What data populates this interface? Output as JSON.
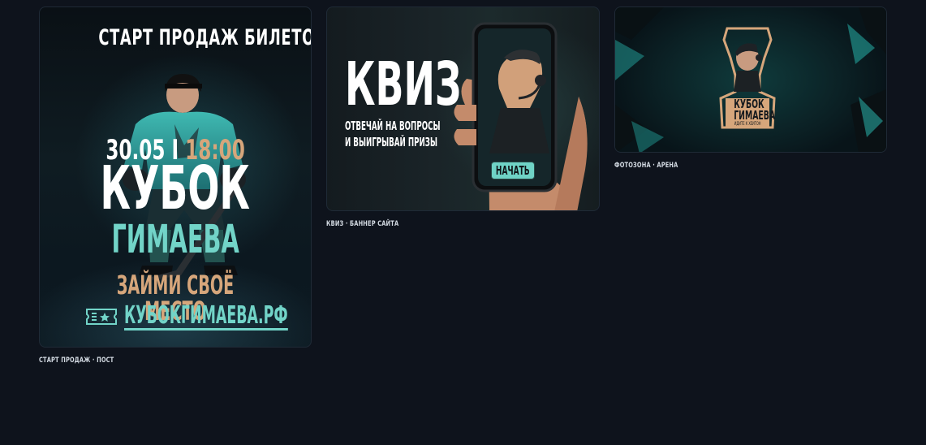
{
  "cards": [
    {
      "id": "poster",
      "top_text": "СТАРТ ПРОДАЖ БИЛЕТОВ",
      "date": "30.05 I",
      "time": "18:00",
      "title": "КУБОК",
      "name": "ГИМАЕВА",
      "slogan": "ЗАЙМИ СВОЁ МЕСТО",
      "site": "КУБОКГИМАЕВА.РФ",
      "caption": "СТАРТ ПРОДАЖ · ПОСТ"
    },
    {
      "id": "quiz",
      "title": "КВИЗ",
      "subtitle_line1": "ОТВЕЧАЙ НА ВОПРОСЫ",
      "subtitle_line2": "И ВЫИГРЫВАЙ ПРИЗЫ",
      "button": "НАЧАТЬ",
      "caption": "КВИЗ · БАННЕР САЙТА"
    },
    {
      "id": "arena",
      "logo_line1": "КУБОК",
      "logo_line2": "ГИМАЕВА",
      "logo_small": "ИДИТЕ К ХЕЙТОН",
      "caption": "ФОТОЗОНА · АРЕНА"
    }
  ],
  "colors": {
    "background": "#0e131c",
    "accent_teal": "#72d4c8",
    "accent_gold": "#d6a67b"
  }
}
